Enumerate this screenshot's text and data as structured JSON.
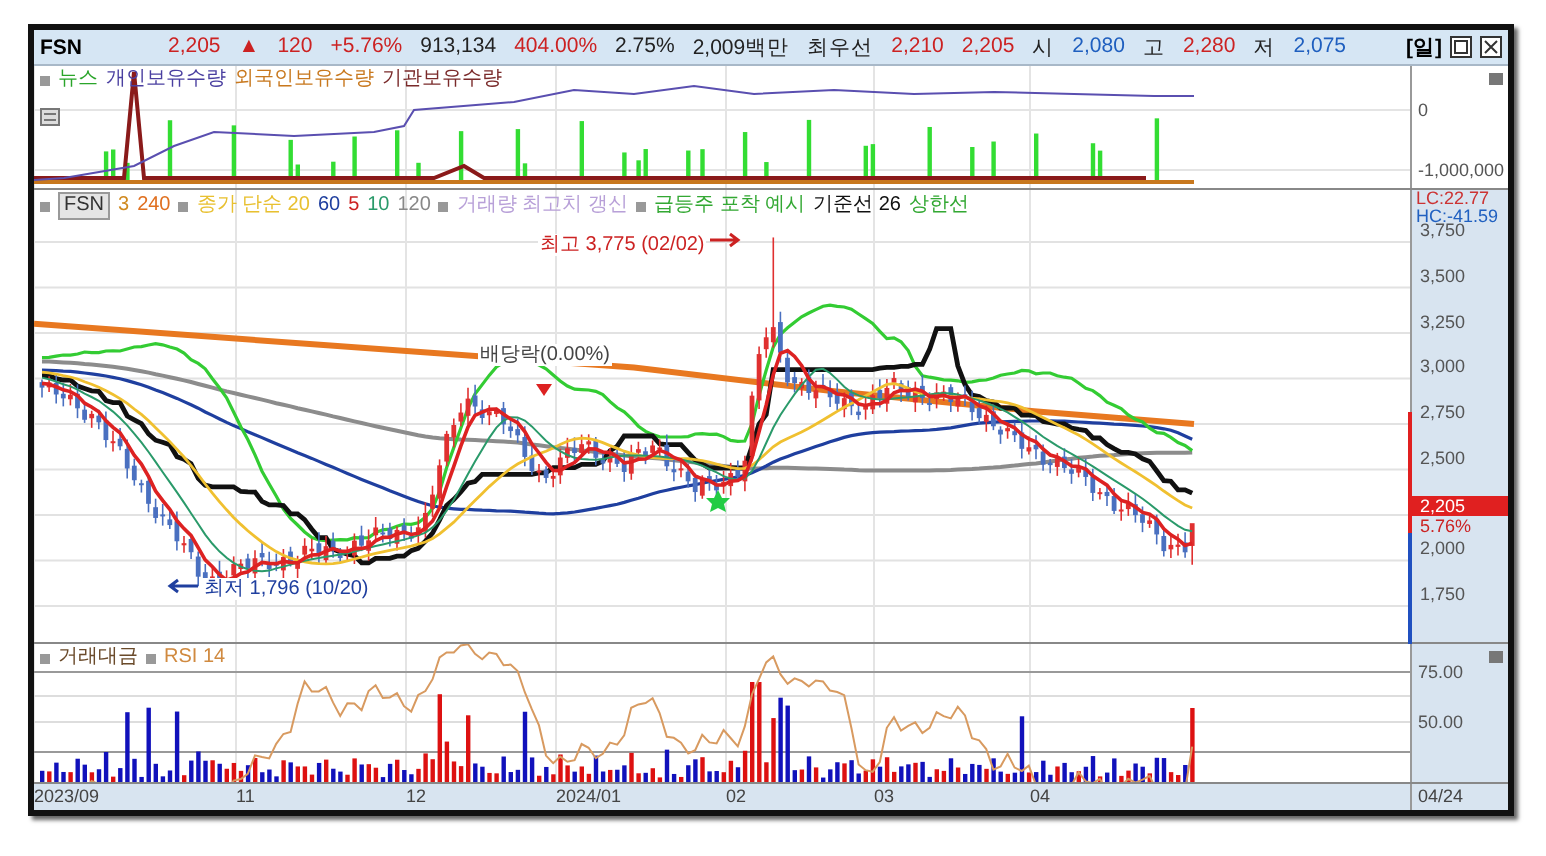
{
  "header": {
    "symbol": "FSN",
    "fields": [
      {
        "text": "2,205",
        "color": "#cc2222"
      },
      {
        "text": "▲",
        "color": "#cc2222"
      },
      {
        "text": "120",
        "color": "#cc2222"
      },
      {
        "text": "+5.76%",
        "color": "#cc2222"
      },
      {
        "text": "913,134",
        "color": "#222222"
      },
      {
        "text": "404.00%",
        "color": "#cc2222"
      },
      {
        "text": "2.75%",
        "color": "#222222"
      },
      {
        "text": "2,009백만",
        "color": "#222222"
      },
      {
        "text": "최우선",
        "color": "#222222"
      },
      {
        "text": "2,210",
        "color": "#cc2222"
      },
      {
        "text": "2,205",
        "color": "#cc2222"
      },
      {
        "text": "시",
        "color": "#222222"
      },
      {
        "text": "2,080",
        "color": "#1f5fbf"
      },
      {
        "text": "고",
        "color": "#222222"
      },
      {
        "text": "2,280",
        "color": "#cc2222"
      },
      {
        "text": "저",
        "color": "#222222"
      },
      {
        "text": "2,075",
        "color": "#1f5fbf"
      }
    ],
    "period": "[일]"
  },
  "holdings_panel": {
    "legend": [
      [
        {
          "text": "뉴스",
          "color": "#2aa52a"
        },
        {
          "text": "개인보유수량",
          "color": "#4a3fa0"
        },
        {
          "text": "외국인보유수량",
          "color": "#c8781e"
        },
        {
          "text": "기관보유수량",
          "color": "#7a2a2a"
        }
      ]
    ],
    "axis": [
      "0",
      "-1,000,000"
    ]
  },
  "price_panel": {
    "legend": [
      [
        {
          "text": "FSN",
          "color": "#333333",
          "kind": "symbol"
        },
        {
          "text": "3",
          "color": "#d08a20",
          "kind": "series"
        },
        {
          "text": "240",
          "color": "#e07020",
          "kind": "series"
        }
      ],
      [
        {
          "text": "종가 단순 20",
          "color": "#e8c030",
          "kind": "series"
        },
        {
          "text": "60",
          "color": "#1f3f9f",
          "kind": "series"
        },
        {
          "text": "5",
          "color": "#cc2222",
          "kind": "series"
        },
        {
          "text": "10",
          "color": "#2a9a6a",
          "kind": "series"
        },
        {
          "text": "120",
          "color": "#888888",
          "kind": "series"
        }
      ],
      [
        {
          "text": "거래량 최고치 갱신",
          "color": "#b8a0d8",
          "kind": "series"
        }
      ],
      [
        {
          "text": "급등주 포착 예시",
          "color": "#33a833",
          "kind": "series"
        },
        {
          "text": "기준선 26",
          "color": "#111111",
          "kind": "series"
        },
        {
          "text": "상한선",
          "color": "#33a833",
          "kind": "series"
        }
      ]
    ],
    "annotations": [
      {
        "text": "최고 3,775 (02/02)",
        "kind": "high"
      },
      {
        "text": "배당락(0.00%)",
        "kind": "dividend"
      },
      {
        "text": "최저 1,796 (10/20)",
        "kind": "low"
      }
    ],
    "axis": {
      "lc": "LC:22.77",
      "hc": "HC:-41.59",
      "ticks_above": [
        "3,750",
        "3,500",
        "3,250",
        "3,000",
        "2,750",
        "2,500"
      ],
      "price_tag": {
        "price": "2,205",
        "change": "5.76%"
      },
      "ticks_below": [
        "2,000",
        "1,750"
      ]
    }
  },
  "volume_panel": {
    "legend": [
      [
        {
          "text": "거래대금",
          "color": "#6a4a2a"
        }
      ],
      [
        {
          "text": "RSI 14",
          "color": "#d08a40"
        }
      ]
    ],
    "axis": [
      "75.00",
      "50.00"
    ]
  },
  "date_axis": {
    "labels": [
      "2023/09",
      "11",
      "12",
      "2024/01",
      "02",
      "03",
      "04"
    ],
    "last_date": "04/24"
  }
}
